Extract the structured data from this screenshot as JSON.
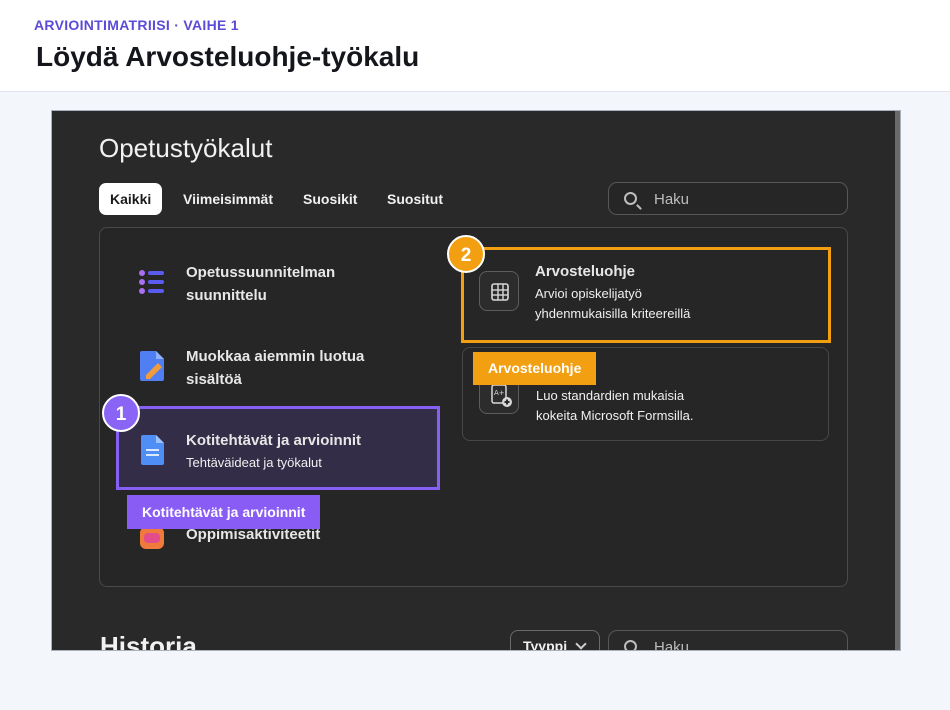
{
  "header": {
    "eyebrow": "ARVIOINTIMATRIISI · VAIHE 1",
    "title": "Löydä Arvosteluohje-työkalu"
  },
  "app": {
    "title": "Opetustyökalut",
    "tabs": [
      "Kaikki",
      "Viimeisimmät",
      "Suosikit",
      "Suositut"
    ],
    "active_tab": "Kaikki",
    "search_placeholder": "Haku"
  },
  "left_items": [
    {
      "title_line1": "Opetussuunnitelman",
      "title_line2": "suunnittelu",
      "icon": "list-icon"
    },
    {
      "title_line1": "Muokkaa aiemmin luotua",
      "title_line2": "sisältöä",
      "icon": "edit-document-icon"
    },
    {
      "title": "Kotitehtävät ja arvioinnit",
      "subtitle": "Tehtäväideat ja työkalut",
      "icon": "document-icon"
    },
    {
      "title": "Oppimisaktiviteetit",
      "icon": "activity-icon"
    }
  ],
  "cards": [
    {
      "title": "Arvosteluohje",
      "sub_line1": "Arvioi opiskelijatyö",
      "sub_line2": "yhdenmukaisilla kriteereillä",
      "icon": "grid-icon"
    },
    {
      "sub_line1": "Luo standardien mukaisia",
      "sub_line2": "kokeita Microsoft Formsilla.",
      "icon": "quiz-icon"
    }
  ],
  "callouts": {
    "step1_number": "1",
    "step1_label": "Kotitehtävät ja arvioinnit",
    "step2_number": "2",
    "step2_label": "Arvosteluohje"
  },
  "history": {
    "title": "Historia",
    "type_label": "Tyyppi",
    "search_placeholder": "Haku"
  },
  "colors": {
    "accent_purple": "#8a64f4",
    "accent_orange": "#f29f12",
    "eyebrow": "#5b4bd6",
    "app_background": "#292929"
  }
}
